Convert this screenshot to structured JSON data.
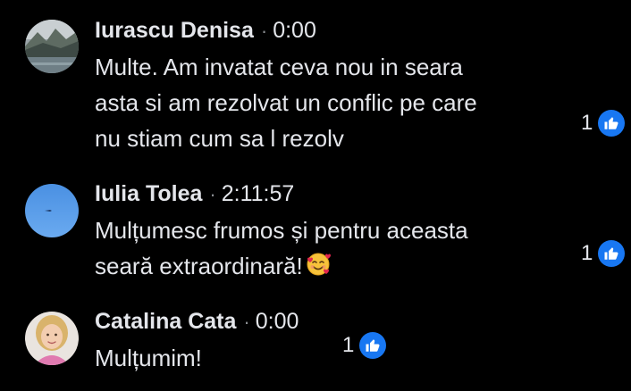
{
  "comments": [
    {
      "author": "Iurascu Denisa",
      "separator": "·",
      "timestamp": "0:00",
      "lines": [
        "Multe. Am invatat ceva nou in seara",
        "asta si am rezolvat un conflic pe care",
        "nu stiam cum sa l rezolv"
      ],
      "reaction_count": "1",
      "reaction_icon": "like-icon",
      "avatar": "landscape-photo"
    },
    {
      "author": "Iulia Tolea",
      "separator": "·",
      "timestamp": "2:11:57",
      "lines": [
        "Mulțumesc frumos și pentru aceasta",
        "seară extraordinară!"
      ],
      "emoji": "smiling-face-with-hearts",
      "reaction_count": "1",
      "reaction_icon": "like-icon",
      "avatar": "blue-sky-photo"
    },
    {
      "author": "Catalina Cata",
      "separator": "·",
      "timestamp": "0:00",
      "lines": [
        "Mulțumim!"
      ],
      "reaction_count": "1",
      "reaction_icon": "like-icon",
      "avatar": "child-portrait"
    }
  ],
  "colors": {
    "background": "#000000",
    "text": "#e4e6eb",
    "like_blue": "#1877f2",
    "muted": "#8a8d91"
  }
}
